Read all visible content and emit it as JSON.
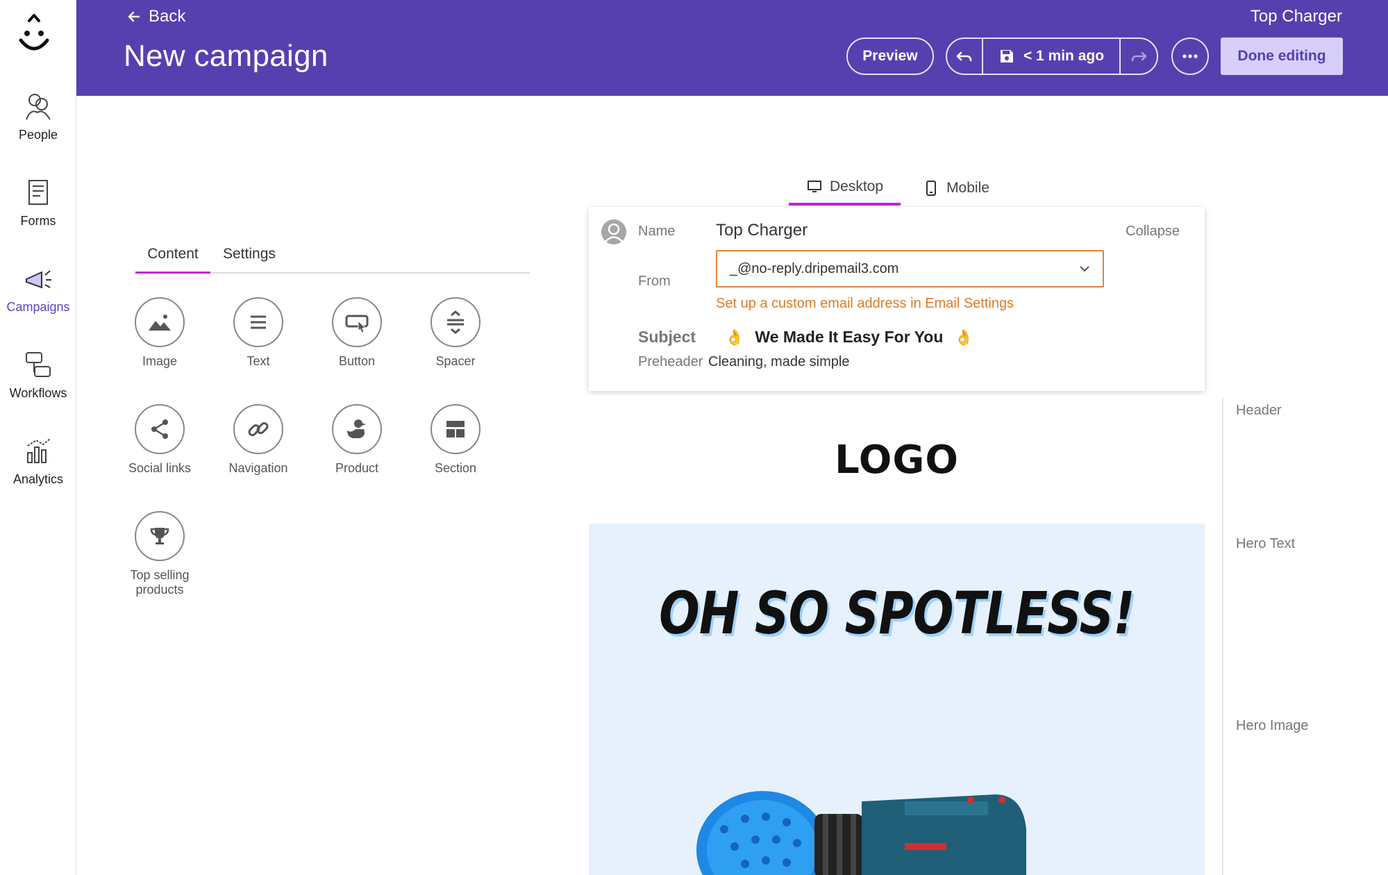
{
  "nav": {
    "items": [
      {
        "label": "People",
        "icon": "people-icon"
      },
      {
        "label": "Forms",
        "icon": "forms-icon"
      },
      {
        "label": "Campaigns",
        "icon": "megaphone-icon",
        "active": true
      },
      {
        "label": "Workflows",
        "icon": "workflows-icon"
      },
      {
        "label": "Analytics",
        "icon": "analytics-icon"
      }
    ]
  },
  "header": {
    "back_label": "Back",
    "title": "New campaign",
    "account": "Top Charger",
    "preview_label": "Preview",
    "save_status": "< 1 min ago",
    "done_label": "Done editing",
    "colors": {
      "bar": "#5640b0",
      "done_bg": "#d7cffa"
    }
  },
  "panel": {
    "tabs": [
      "Content",
      "Settings"
    ],
    "active_tab": "Content",
    "tools": [
      {
        "label": "Image",
        "icon": "image-icon"
      },
      {
        "label": "Text",
        "icon": "text-icon"
      },
      {
        "label": "Button",
        "icon": "button-icon"
      },
      {
        "label": "Spacer",
        "icon": "spacer-icon"
      },
      {
        "label": "Social links",
        "icon": "share-icon"
      },
      {
        "label": "Navigation",
        "icon": "link-icon"
      },
      {
        "label": "Product",
        "icon": "duck-icon"
      },
      {
        "label": "Section",
        "icon": "section-icon"
      },
      {
        "label": "Top selling products",
        "icon": "trophy-icon"
      }
    ]
  },
  "preview": {
    "device_tabs": [
      "Desktop",
      "Mobile"
    ],
    "active_device": "Desktop"
  },
  "settings": {
    "name_label": "Name",
    "name_value": "Top Charger",
    "collapse_label": "Collapse",
    "from_label": "From",
    "from_value": "_@no-reply.dripemail3.com",
    "from_warning": "Set up a custom email address in Email Settings",
    "subject_label": "Subject",
    "subject_emoji": "👌",
    "subject_value": "We Made It Easy For You",
    "preheader_label": "Preheader",
    "preheader_value": "Cleaning, made simple"
  },
  "email": {
    "logo_text": "LOGO",
    "hero_text": "OH SO SPOTLESS!",
    "hero_bg": "#e6f1fd"
  },
  "outline": [
    "Header",
    "Hero Text",
    "Hero Image"
  ]
}
